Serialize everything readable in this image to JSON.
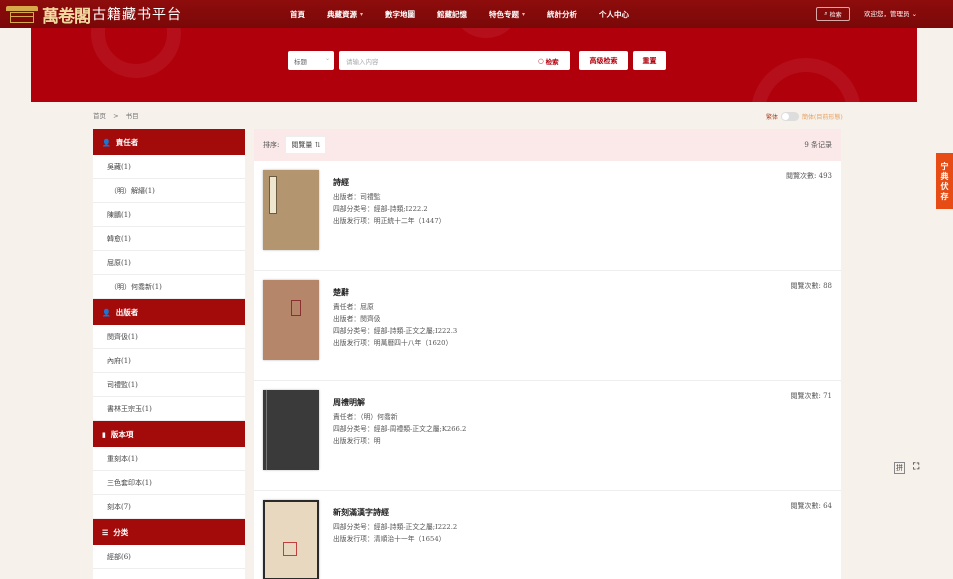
{
  "header": {
    "logo_calligraphy": "萬卷閣",
    "logo_text": "古籍藏书平台",
    "nav": [
      {
        "label": "首頁",
        "has_menu": false
      },
      {
        "label": "典藏資源",
        "has_menu": true
      },
      {
        "label": "數字地圖",
        "has_menu": false
      },
      {
        "label": "館藏記憶",
        "has_menu": false
      },
      {
        "label": "特色专题",
        "has_menu": true
      },
      {
        "label": "統計分析",
        "has_menu": false
      },
      {
        "label": "个人中心",
        "has_menu": false
      }
    ],
    "search_button": "检索",
    "welcome": "欢迎您，管理员"
  },
  "search": {
    "field_select": "标题",
    "placeholder": "请输入内容",
    "search_label": "检索",
    "advanced_button": "高级检索",
    "reset_button": "重置"
  },
  "breadcrumb": [
    "首页",
    "书目"
  ],
  "script_toggle": {
    "left": "繁体",
    "right": "簡体(目前形態)"
  },
  "sidebar": [
    {
      "heading": "責任者",
      "icon": "person-icon",
      "items": [
        {
          "label": "吳藏(1)",
          "indent": false
        },
        {
          "label": "（明）解縉(1)",
          "indent": true
        },
        {
          "label": "陳鵬(1)",
          "indent": false
        },
        {
          "label": "韓愈(1)",
          "indent": false
        },
        {
          "label": "屈原(1)",
          "indent": false
        },
        {
          "label": "（明）何喬新(1)",
          "indent": true
        }
      ]
    },
    {
      "heading": "出版者",
      "icon": "person-icon",
      "items": [
        {
          "label": "閔齊伋(1)",
          "indent": false
        },
        {
          "label": "內府(1)",
          "indent": false
        },
        {
          "label": "司禮監(1)",
          "indent": false
        },
        {
          "label": "書林王宗玉(1)",
          "indent": false
        }
      ]
    },
    {
      "heading": "版本項",
      "icon": "book-icon",
      "items": [
        {
          "label": "重刻本(1)",
          "indent": false
        },
        {
          "label": "三色套印本(1)",
          "indent": false
        },
        {
          "label": "刻本(7)",
          "indent": false
        }
      ]
    },
    {
      "heading": "分类",
      "icon": "list-icon",
      "items": [
        {
          "label": "經部(6)",
          "indent": false
        }
      ]
    }
  ],
  "results": {
    "sort_label": "排序:",
    "sort_option": "閱覽量",
    "count_text": "9 条记录",
    "views_prefix": "閱覽次數:",
    "books": [
      {
        "title": "詩經",
        "meta": [
          "出版者：司禮監",
          "四部分类号：經部-詩類;I222.2",
          "出版发行项：明正統十二年（1447）"
        ],
        "views": "493",
        "cover_color": "#b39670"
      },
      {
        "title": "楚辭",
        "meta": [
          "責任者：屈原",
          "出版者：閔齊伋",
          "四部分类号：經部-詩類-正文之屬;I222.3",
          "出版发行项：明萬曆四十八年（1620）"
        ],
        "views": "88",
        "cover_color": "#b5866a"
      },
      {
        "title": "周禮明解",
        "meta": [
          "責任者：（明）何喬新",
          "四部分类号：經部-周禮類-正文之屬;K266.2",
          "出版发行项：明"
        ],
        "views": "71",
        "cover_color": "#3a3a3a"
      },
      {
        "title": "新刻滿漢字詩經",
        "meta": [
          "四部分类号：經部-詩類-正文之屬;I222.2",
          "出版发行项：清順治十一年（1654）"
        ],
        "views": "64",
        "cover_color": "#e8d8c0"
      }
    ]
  },
  "side_tab": [
    "宁",
    "典",
    "伏",
    "存"
  ],
  "tools": [
    "拼"
  ]
}
